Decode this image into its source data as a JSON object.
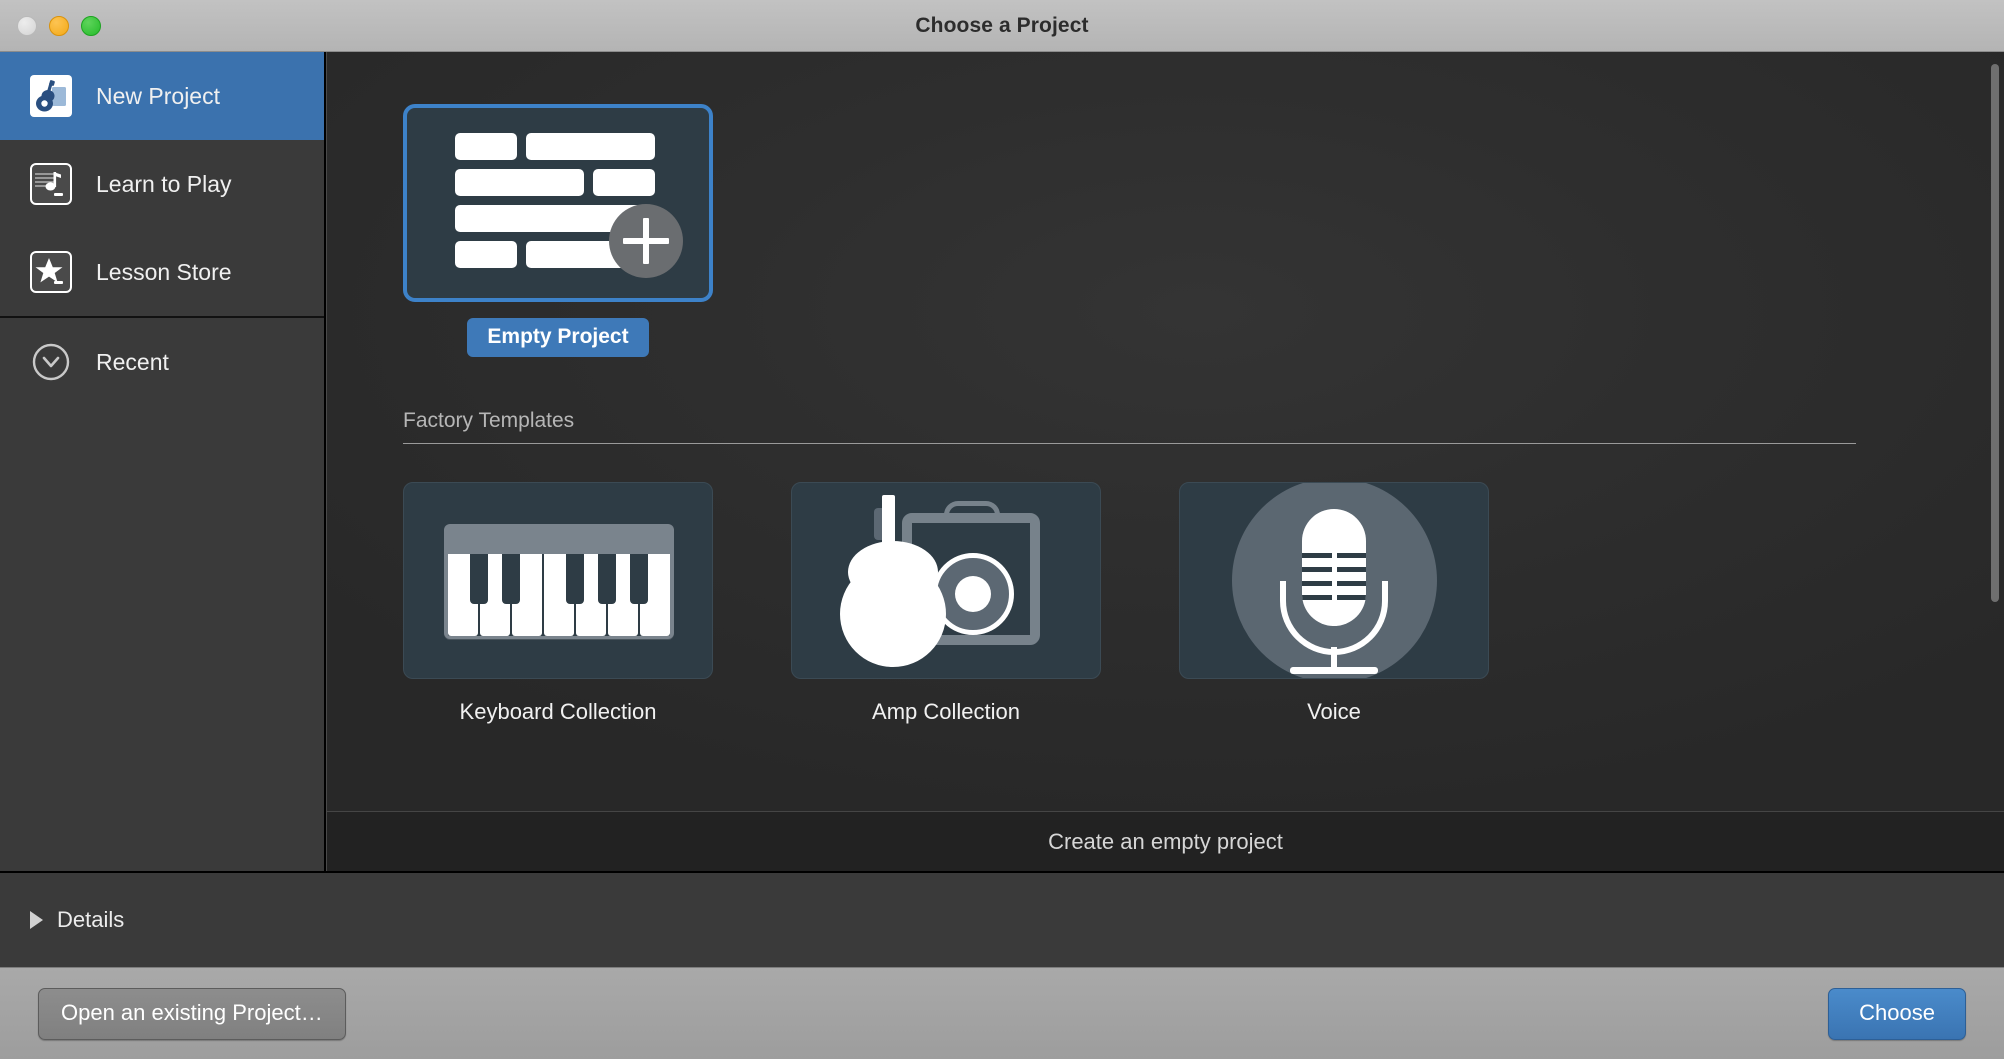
{
  "window": {
    "title": "Choose a Project",
    "traffic_lights": [
      "close-button",
      "minimize-button",
      "zoom-button"
    ]
  },
  "sidebar": {
    "groups": [
      {
        "items": [
          {
            "label": "New Project",
            "icon": "guitar-card-icon",
            "selected": true
          },
          {
            "label": "Learn to Play",
            "icon": "music-note-card-icon",
            "selected": false
          },
          {
            "label": "Lesson Store",
            "icon": "star-card-icon",
            "selected": false
          }
        ]
      },
      {
        "items": [
          {
            "label": "Recent",
            "icon": "clock-icon",
            "selected": false
          }
        ]
      }
    ]
  },
  "main": {
    "hero": {
      "label": "Empty Project",
      "icon": "empty-project-regions-icon",
      "selected": true,
      "badge": "plus-icon"
    },
    "section": {
      "title": "Factory Templates"
    },
    "templates": [
      {
        "label": "Keyboard Collection",
        "icon": "piano-keyboard-icon"
      },
      {
        "label": "Amp Collection",
        "icon": "guitar-amp-icon"
      },
      {
        "label": "Voice",
        "icon": "microphone-icon"
      }
    ],
    "status_text": "Create an empty project"
  },
  "details": {
    "label": "Details",
    "expanded": false,
    "disclosure_icon": "triangle-right-icon"
  },
  "footer": {
    "open_existing_label": "Open an existing Project…",
    "choose_label": "Choose"
  },
  "colors": {
    "accent_blue": "#3e79b8",
    "selection_blue": "#3b72ae",
    "tile_bg": "#2e3c45",
    "sidebar_bg": "#3a3a3a",
    "content_bg": "#2b2b2b"
  }
}
